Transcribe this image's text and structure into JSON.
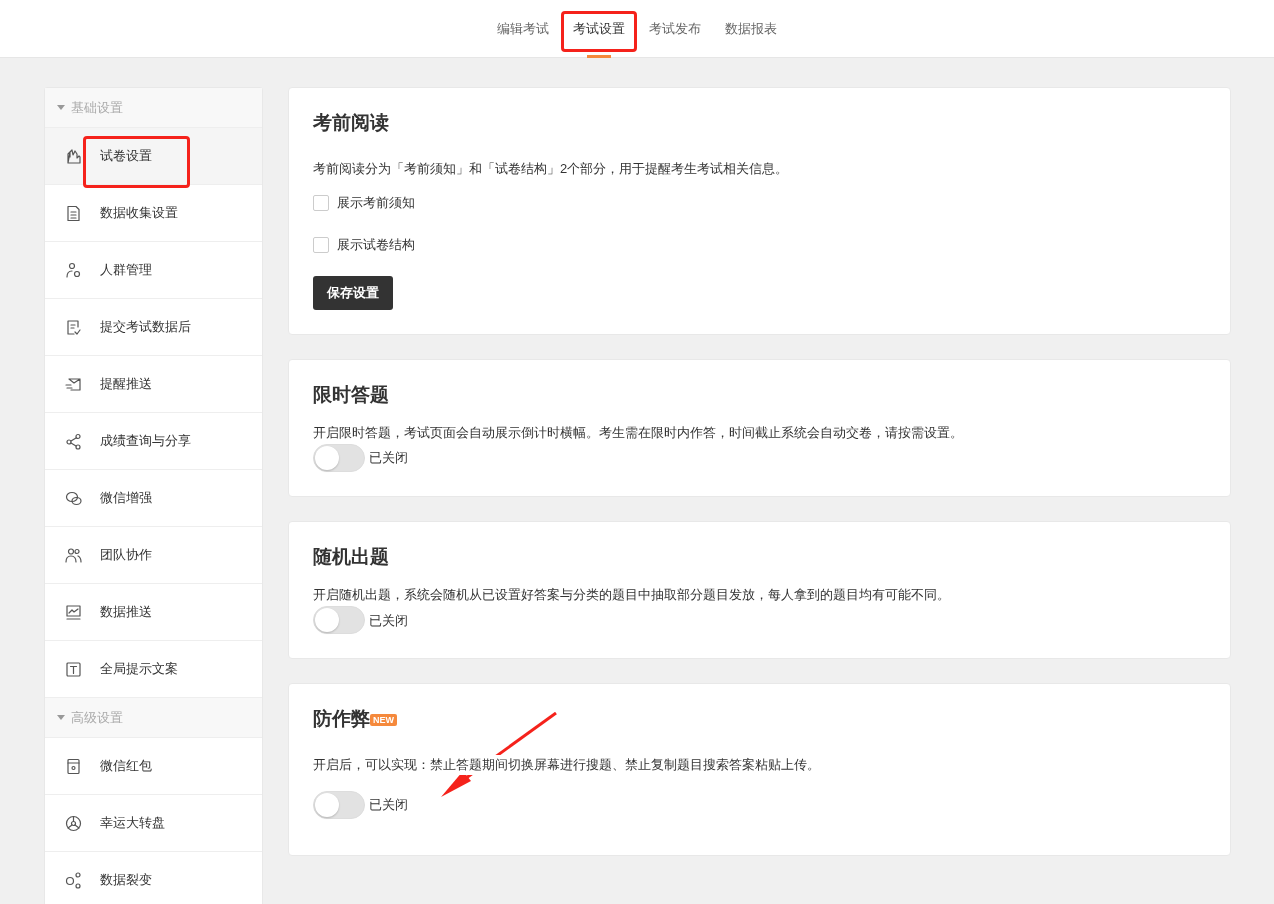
{
  "tabs": [
    {
      "label": "编辑考试",
      "selected": false,
      "highlighted": false
    },
    {
      "label": "考试设置",
      "selected": true,
      "highlighted": true
    },
    {
      "label": "考试发布",
      "selected": false,
      "highlighted": false
    },
    {
      "label": "数据报表",
      "selected": false,
      "highlighted": false
    }
  ],
  "sidebar": {
    "groups": [
      {
        "title": "基础设置",
        "expanded": true,
        "items": [
          {
            "label": "试卷设置",
            "selected": true,
            "highlighted": true
          },
          {
            "label": "数据收集设置",
            "selected": false,
            "highlighted": false
          },
          {
            "label": "人群管理",
            "selected": false,
            "highlighted": false
          },
          {
            "label": "提交考试数据后",
            "selected": false,
            "highlighted": false
          },
          {
            "label": "提醒推送",
            "selected": false,
            "highlighted": false
          },
          {
            "label": "成绩查询与分享",
            "selected": false,
            "highlighted": false
          },
          {
            "label": "微信增强",
            "selected": false,
            "highlighted": false
          },
          {
            "label": "团队协作",
            "selected": false,
            "highlighted": false
          },
          {
            "label": "数据推送",
            "selected": false,
            "highlighted": false
          },
          {
            "label": "全局提示文案",
            "selected": false,
            "highlighted": false
          }
        ]
      },
      {
        "title": "高级设置",
        "expanded": true,
        "items": [
          {
            "label": "微信红包",
            "selected": false,
            "highlighted": false
          },
          {
            "label": "幸运大转盘",
            "selected": false,
            "highlighted": false
          },
          {
            "label": "数据裂变",
            "selected": false,
            "highlighted": false
          }
        ]
      }
    ]
  },
  "cards": [
    {
      "title": "考前阅读",
      "description": "考前阅读分为「考前须知」和「试卷结构」2个部分，用于提醒考生考试相关信息。",
      "options": [
        {
          "label": "展示考前须知",
          "checked": false
        },
        {
          "label": "展示试卷结构",
          "checked": false
        }
      ],
      "button": "保存设置",
      "arrow": false
    },
    {
      "title": "限时答题",
      "description": "开启限时答题，考试页面会自动展示倒计时横幅。考生需在限时内作答，时间截止系统会自动交卷，请按需设置。",
      "toggle": {
        "on": false,
        "label": "已关闭"
      },
      "arrow": false
    },
    {
      "title": "随机出题",
      "description": "开启随机出题，系统会随机从已设置好答案与分类的题目中抽取部分题目发放，每人拿到的题目均有可能不同。",
      "toggle": {
        "on": false,
        "label": "已关闭"
      },
      "arrow": false
    },
    {
      "title": "防作弊",
      "badge": "NEW",
      "description": "开启后，可以实现：禁止答题期间切换屏幕进行搜题、禁止复制题目搜索答案粘贴上传。",
      "toggle": {
        "on": false,
        "label": "已关闭"
      },
      "arrow": true
    }
  ]
}
